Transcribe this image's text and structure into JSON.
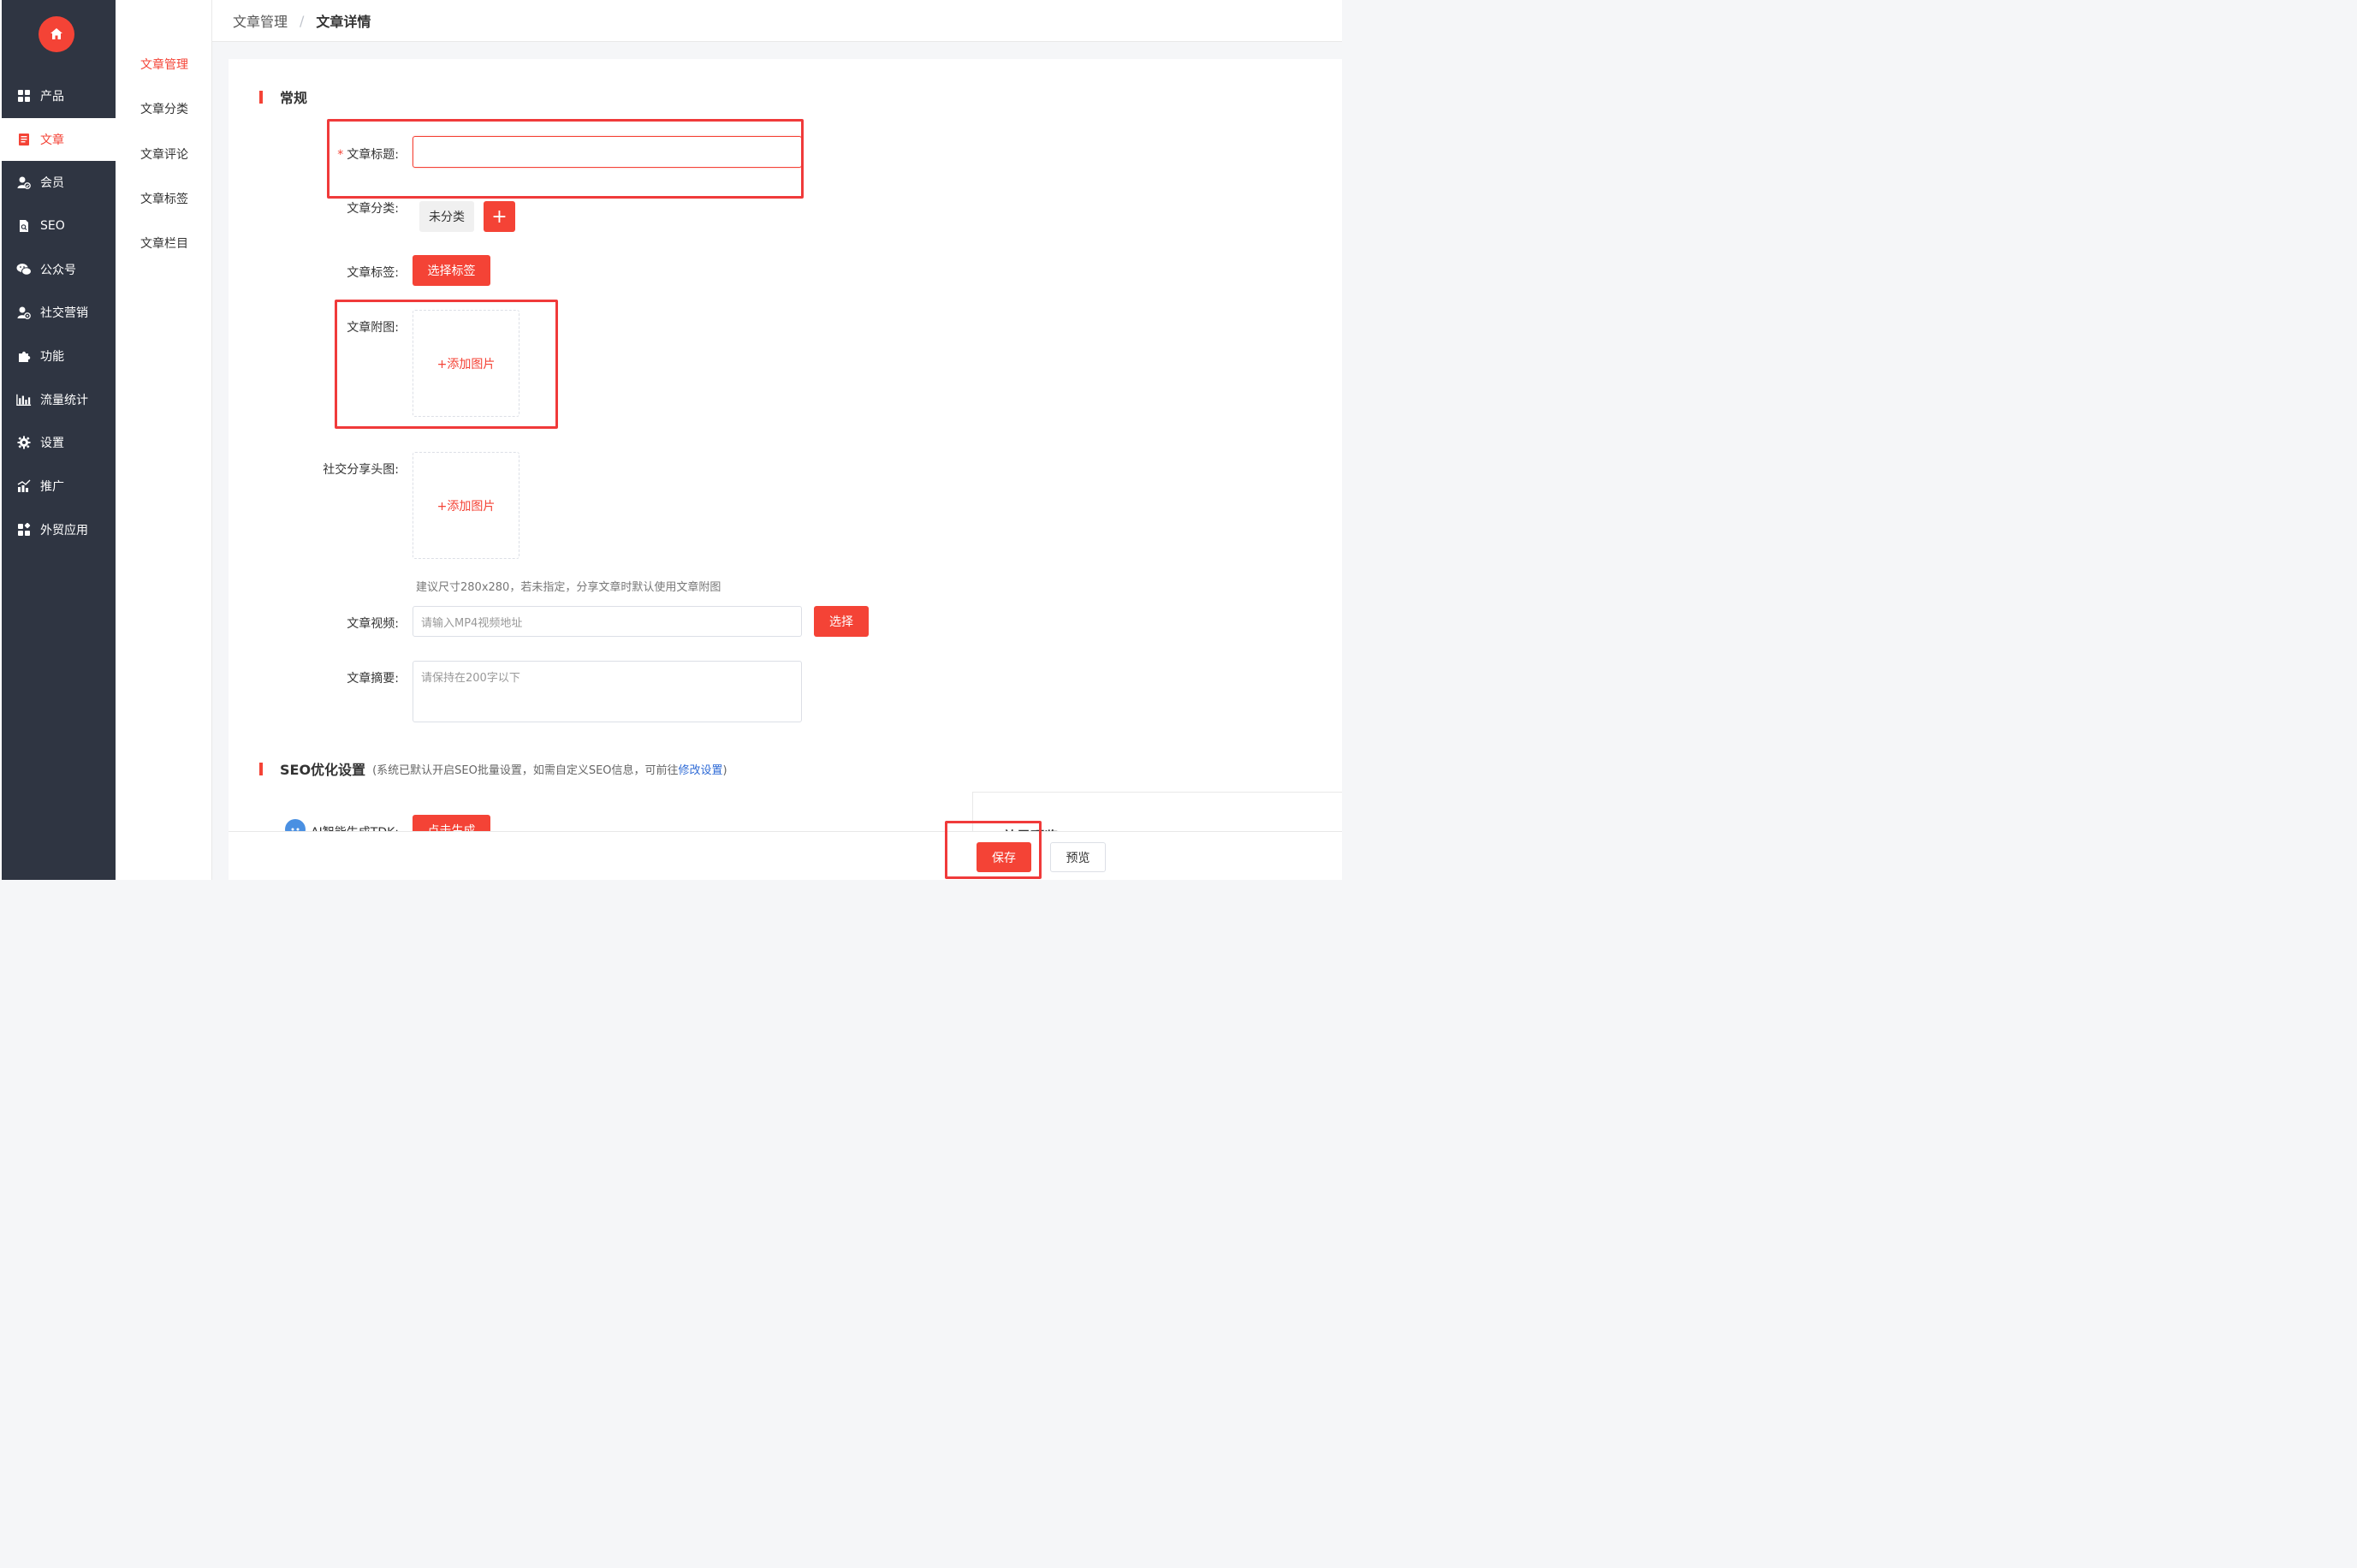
{
  "colors": {
    "accent": "#f44336",
    "sidebar_bg": "#2f3542",
    "link": "#2f6bd6",
    "highlight": "#f03a3a"
  },
  "sidebar": {
    "logo_icon": "home-icon",
    "items": [
      {
        "label": "产品",
        "icon": "grid-icon"
      },
      {
        "label": "文章",
        "icon": "document-icon",
        "active": true
      },
      {
        "label": "会员",
        "icon": "member-icon"
      },
      {
        "label": "SEO",
        "icon": "seo-file-icon"
      },
      {
        "label": "公众号",
        "icon": "wechat-icon"
      },
      {
        "label": "社交营销",
        "icon": "social-icon"
      },
      {
        "label": "功能",
        "icon": "puzzle-icon"
      },
      {
        "label": "流量统计",
        "icon": "bar-chart-icon"
      },
      {
        "label": "设置",
        "icon": "gear-icon"
      },
      {
        "label": "推广",
        "icon": "growth-chart-icon"
      },
      {
        "label": "外贸应用",
        "icon": "apps-icon"
      }
    ]
  },
  "subnav": {
    "items": [
      {
        "label": "文章管理",
        "active": true
      },
      {
        "label": "文章分类"
      },
      {
        "label": "文章评论"
      },
      {
        "label": "文章标签"
      },
      {
        "label": "文章栏目"
      }
    ]
  },
  "breadcrumb": {
    "parent": "文章管理",
    "separator": "/",
    "current": "文章详情"
  },
  "general": {
    "title": "常规",
    "article_title_label": "文章标题:",
    "required_mark": "*",
    "article_title_value": "",
    "category_label": "文章分类:",
    "category_value": "未分类",
    "add_category_button": "+",
    "tag_label": "文章标签:",
    "tag_button": "选择标签",
    "image_label": "文章附图:",
    "image_upload": "+添加图片",
    "share_label": "社交分享头图:",
    "share_upload": "+添加图片",
    "share_hint": "建议尺寸280x280，若未指定，分享文章时默认使用文章附图",
    "video_label": "文章视频:",
    "video_placeholder": "请输入MP4视频地址",
    "video_button": "选择",
    "summary_label": "文章摘要:",
    "summary_placeholder": "请保持在200字以下"
  },
  "seo": {
    "title": "SEO优化设置",
    "note_prefix": "(系统已默认开启SEO批量设置，如需自定义SEO信息，可前往",
    "note_link": "修改设置",
    "note_suffix": ")",
    "ai_label": "AI智能生成TDK:",
    "ai_button": "点击生成",
    "preview_title": "效果预览"
  },
  "footer": {
    "save_button": "保存",
    "preview_button": "预览"
  }
}
